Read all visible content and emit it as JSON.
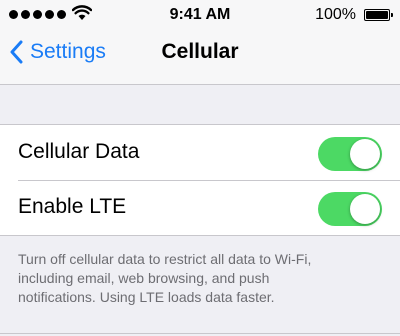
{
  "status_bar": {
    "time": "9:41 AM",
    "battery_percent": "100%",
    "signal_icon": "signal-dots-icon",
    "wifi_icon": "wifi-icon",
    "battery_icon": "battery-icon"
  },
  "nav": {
    "back_label": "Settings",
    "back_icon": "chevron-left-icon",
    "title": "Cellular"
  },
  "settings": [
    {
      "label": "Cellular Data",
      "enabled": true
    },
    {
      "label": "Enable LTE",
      "enabled": true
    }
  ],
  "footer_lines": [
    "Turn off cellular data to restrict all data to Wi-Fi,",
    "including email, web browsing, and push",
    "notifications. Using LTE loads data faster."
  ],
  "colors": {
    "accent": "#1a7cf6",
    "toggle_on": "#4cd964",
    "background": "#efeff4"
  }
}
